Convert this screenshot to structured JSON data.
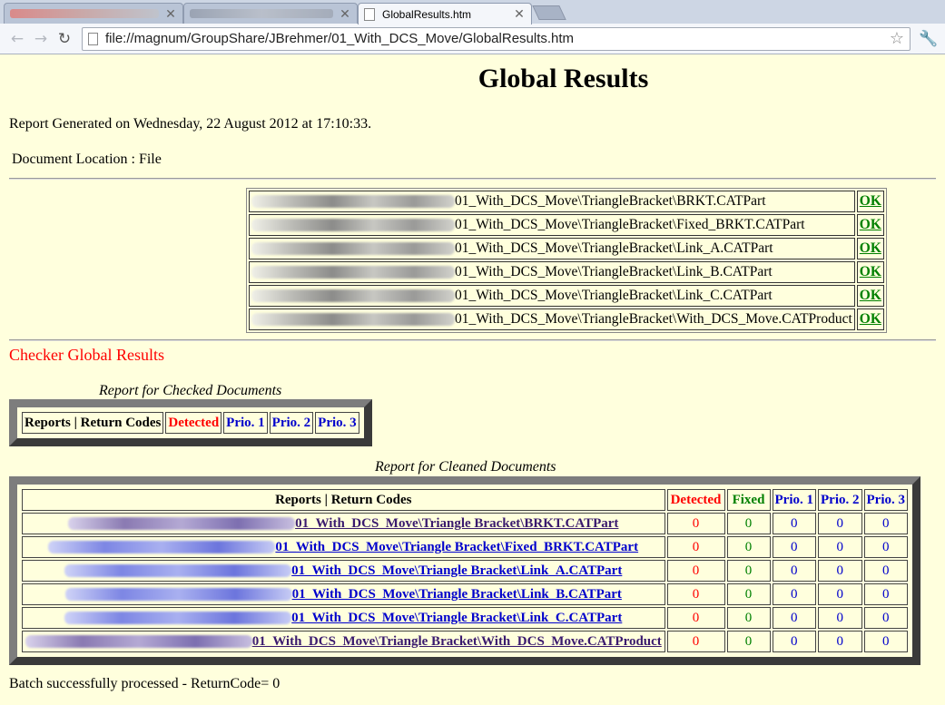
{
  "browser": {
    "tabs": [
      {
        "label": "",
        "blurred": true
      },
      {
        "label": "",
        "blurred": true
      },
      {
        "label": "GlobalResults.htm",
        "blurred": false
      }
    ],
    "url": "file://magnum/GroupShare/JBrehmer/01_With_DCS_Move/GlobalResults.htm",
    "icons": {
      "back": "back-arrow-icon",
      "forward": "forward-arrow-icon",
      "reload": "reload-icon",
      "star": "bookmark-star-icon",
      "wrench": "wrench-icon",
      "close": "close-icon",
      "page": "page-icon"
    }
  },
  "page": {
    "title": "Global Results",
    "generated": "Report Generated on Wednesday, 22 August 2012 at 17:10:33.",
    "location": "Document Location : File",
    "documents": [
      {
        "path": "01_With_DCS_Move\\TriangleBracket\\BRKT.CATPart",
        "status": "OK"
      },
      {
        "path": "01_With_DCS_Move\\TriangleBracket\\Fixed_BRKT.CATPart",
        "status": "OK"
      },
      {
        "path": "01_With_DCS_Move\\TriangleBracket\\Link_A.CATPart",
        "status": "OK"
      },
      {
        "path": "01_With_DCS_Move\\TriangleBracket\\Link_B.CATPart",
        "status": "OK"
      },
      {
        "path": "01_With_DCS_Move\\TriangleBracket\\Link_C.CATPart",
        "status": "OK"
      },
      {
        "path": "01_With_DCS_Move\\TriangleBracket\\With_DCS_Move.CATProduct",
        "status": "OK"
      }
    ],
    "checker_title": "Checker Global Results",
    "checked": {
      "caption": "Report for Checked Documents",
      "headers": [
        "Reports | Return Codes",
        "Detected",
        "Prio. 1",
        "Prio. 2",
        "Prio. 3"
      ]
    },
    "cleaned": {
      "caption": "Report for Cleaned Documents",
      "headers": [
        "Reports | Return Codes",
        "Detected",
        "Fixed",
        "Prio. 1",
        "Prio. 2",
        "Prio. 3"
      ],
      "rows": [
        {
          "doc": "01_With_DCS_Move\\Triangle Bracket\\BRKT.CATPart",
          "detected": "0",
          "fixed": "0",
          "p1": "0",
          "p2": "0",
          "p3": "0"
        },
        {
          "doc": "01_With_DCS_Move\\Triangle Bracket\\Fixed_BRKT.CATPart",
          "detected": "0",
          "fixed": "0",
          "p1": "0",
          "p2": "0",
          "p3": "0"
        },
        {
          "doc": "01_With_DCS_Move\\Triangle Bracket\\Link_A.CATPart",
          "detected": "0",
          "fixed": "0",
          "p1": "0",
          "p2": "0",
          "p3": "0"
        },
        {
          "doc": "01_With_DCS_Move\\Triangle Bracket\\Link_B.CATPart",
          "detected": "0",
          "fixed": "0",
          "p1": "0",
          "p2": "0",
          "p3": "0"
        },
        {
          "doc": "01_With_DCS_Move\\Triangle Bracket\\Link_C.CATPart",
          "detected": "0",
          "fixed": "0",
          "p1": "0",
          "p2": "0",
          "p3": "0"
        },
        {
          "doc": "01_With_DCS_Move\\Triangle Bracket\\With_DCS_Move.CATProduct",
          "detected": "0",
          "fixed": "0",
          "p1": "0",
          "p2": "0",
          "p3": "0"
        }
      ]
    },
    "footer": "Batch successfully processed - ReturnCode= 0",
    "colors": {
      "background": "#ffffdd",
      "red": "#ff0000",
      "green": "#008000",
      "blue": "#0000cc"
    }
  }
}
